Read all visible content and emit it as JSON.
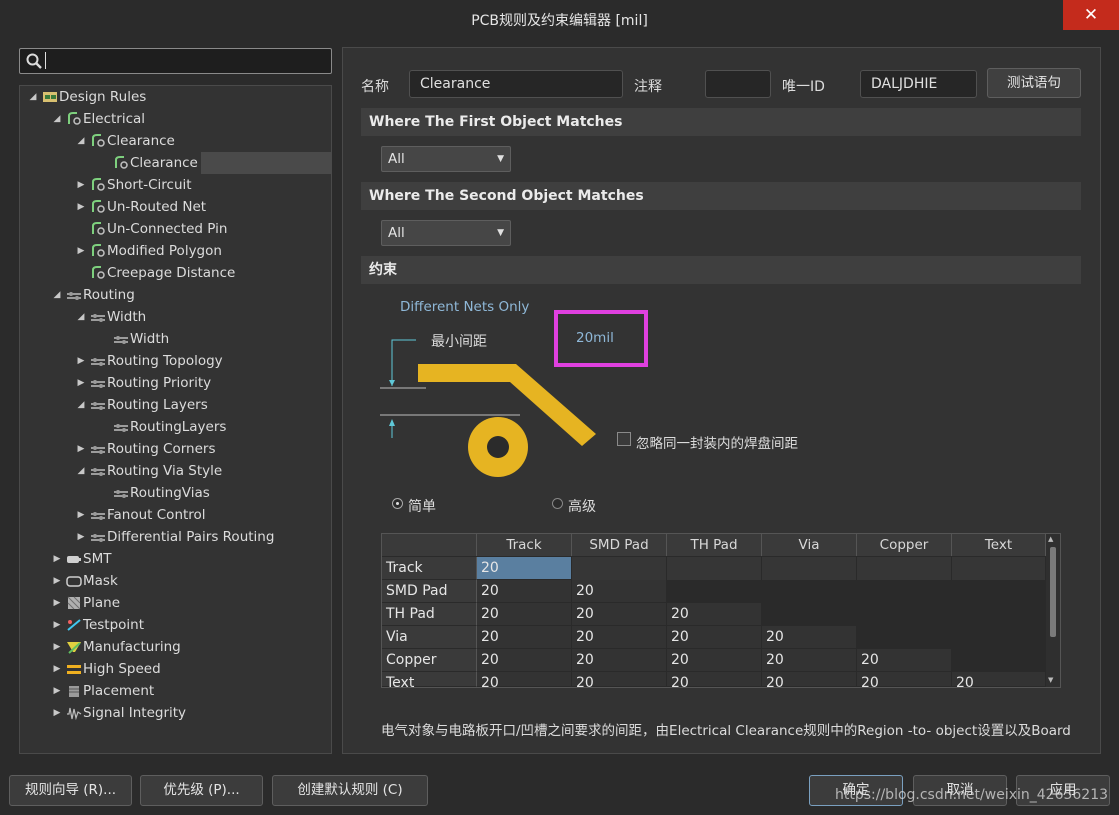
{
  "window": {
    "title": "PCB规则及约束编辑器 [mil]",
    "close_glyph": "✕"
  },
  "search": {
    "value": ""
  },
  "tree": [
    {
      "label": "Design Rules",
      "level": 0,
      "arrow": "◢",
      "icon": "rules-folder-icon"
    },
    {
      "label": "Electrical",
      "level": 1,
      "arrow": "◢",
      "icon": "rule-icon"
    },
    {
      "label": "Clearance",
      "level": 2,
      "arrow": "◢",
      "icon": "rule-icon"
    },
    {
      "label": "Clearance",
      "level": 3,
      "arrow": "",
      "icon": "rule-icon",
      "selected": true
    },
    {
      "label": "Short-Circuit",
      "level": 2,
      "arrow": "▶",
      "icon": "rule-icon"
    },
    {
      "label": "Un-Routed Net",
      "level": 2,
      "arrow": "▶",
      "icon": "rule-icon"
    },
    {
      "label": "Un-Connected Pin",
      "level": 2,
      "arrow": "",
      "icon": "rule-icon"
    },
    {
      "label": "Modified Polygon",
      "level": 2,
      "arrow": "▶",
      "icon": "rule-icon"
    },
    {
      "label": "Creepage Distance",
      "level": 2,
      "arrow": "",
      "icon": "rule-icon"
    },
    {
      "label": "Routing",
      "level": 1,
      "arrow": "◢",
      "icon": "routing-icon"
    },
    {
      "label": "Width",
      "level": 2,
      "arrow": "◢",
      "icon": "routing-icon"
    },
    {
      "label": "Width",
      "level": 3,
      "arrow": "",
      "icon": "routing-icon"
    },
    {
      "label": "Routing Topology",
      "level": 2,
      "arrow": "▶",
      "icon": "routing-icon"
    },
    {
      "label": "Routing Priority",
      "level": 2,
      "arrow": "▶",
      "icon": "routing-icon"
    },
    {
      "label": "Routing Layers",
      "level": 2,
      "arrow": "◢",
      "icon": "routing-icon"
    },
    {
      "label": "RoutingLayers",
      "level": 3,
      "arrow": "",
      "icon": "routing-icon"
    },
    {
      "label": "Routing Corners",
      "level": 2,
      "arrow": "▶",
      "icon": "routing-icon"
    },
    {
      "label": "Routing Via Style",
      "level": 2,
      "arrow": "◢",
      "icon": "routing-icon"
    },
    {
      "label": "RoutingVias",
      "level": 3,
      "arrow": "",
      "icon": "routing-icon"
    },
    {
      "label": "Fanout Control",
      "level": 2,
      "arrow": "▶",
      "icon": "routing-icon"
    },
    {
      "label": "Differential Pairs Routing",
      "level": 2,
      "arrow": "▶",
      "icon": "routing-icon"
    },
    {
      "label": "SMT",
      "level": 1,
      "arrow": "▶",
      "icon": "smt-icon"
    },
    {
      "label": "Mask",
      "level": 1,
      "arrow": "▶",
      "icon": "mask-icon"
    },
    {
      "label": "Plane",
      "level": 1,
      "arrow": "▶",
      "icon": "plane-icon"
    },
    {
      "label": "Testpoint",
      "level": 1,
      "arrow": "▶",
      "icon": "testpoint-icon"
    },
    {
      "label": "Manufacturing",
      "level": 1,
      "arrow": "▶",
      "icon": "manufacturing-icon"
    },
    {
      "label": "High Speed",
      "level": 1,
      "arrow": "▶",
      "icon": "high-speed-icon"
    },
    {
      "label": "Placement",
      "level": 1,
      "arrow": "▶",
      "icon": "placement-icon"
    },
    {
      "label": "Signal Integrity",
      "level": 1,
      "arrow": "▶",
      "icon": "signal-integrity-icon"
    }
  ],
  "rule": {
    "name_label": "名称",
    "name_value": "Clearance",
    "comment_label": "注释",
    "comment_value": "",
    "uid_label": "唯一ID",
    "uid_value": "DALJDHIE",
    "test_button": "测试语句"
  },
  "first_match": {
    "heading": "Where The First Object Matches",
    "value": "All"
  },
  "second_match": {
    "heading": "Where The Second Object Matches",
    "value": "All"
  },
  "constraints": {
    "heading": "约束",
    "net_scope": "Different Nets Only",
    "min_gap_label": "最小间距",
    "min_gap_value": "20mil",
    "ignore_pads_label": "忽略同一封装内的焊盘间距",
    "ignore_pads_checked": false,
    "mode_simple": "简单",
    "mode_advanced": "高级",
    "mode_selected": "simple",
    "table": {
      "columns": [
        "Track",
        "SMD Pad",
        "TH Pad",
        "Via",
        "Copper",
        "Text"
      ],
      "rows": [
        {
          "label": "Track",
          "values": [
            "20"
          ]
        },
        {
          "label": "SMD Pad",
          "values": [
            "20",
            "20"
          ]
        },
        {
          "label": "TH Pad",
          "values": [
            "20",
            "20",
            "20"
          ]
        },
        {
          "label": "Via",
          "values": [
            "20",
            "20",
            "20",
            "20"
          ]
        },
        {
          "label": "Copper",
          "values": [
            "20",
            "20",
            "20",
            "20",
            "20"
          ]
        },
        {
          "label": "Text",
          "values": [
            "20",
            "20",
            "20",
            "20",
            "20",
            "20"
          ]
        }
      ]
    },
    "description": "电气对象与电路板开口/凹槽之间要求的间距，由Electrical Clearance规则中的Region -to- object设置以及Board"
  },
  "colors": {
    "highlight": "#e040e0",
    "copper": "#e6b422",
    "accent_text": "#8fb8d8",
    "selected_cell": "#5a7fa0"
  },
  "footer": {
    "wizard": "规则向导 (R)...",
    "priority": "优先级 (P)...",
    "create_default": "创建默认规则 (C)",
    "ok": "确定",
    "cancel": "取消",
    "apply": "应用",
    "watermark": "https://blog.csdn.net/weixin_42656213"
  }
}
